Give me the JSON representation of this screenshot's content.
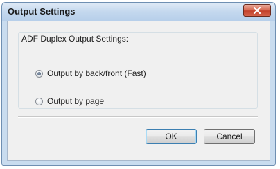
{
  "window": {
    "title": "Output Settings",
    "close_icon": "close-icon"
  },
  "group": {
    "label": "ADF Duplex Output Settings:"
  },
  "options": [
    {
      "label": "Output by back/front (Fast)",
      "selected": true
    },
    {
      "label": "Output by page",
      "selected": false
    }
  ],
  "buttons": {
    "ok_label": "OK",
    "cancel_label": "Cancel"
  },
  "colors": {
    "frame": "#c9dcef",
    "client": "#f0f0f0",
    "close_button": "#c2402a",
    "default_button_border": "#3c7fb1"
  }
}
